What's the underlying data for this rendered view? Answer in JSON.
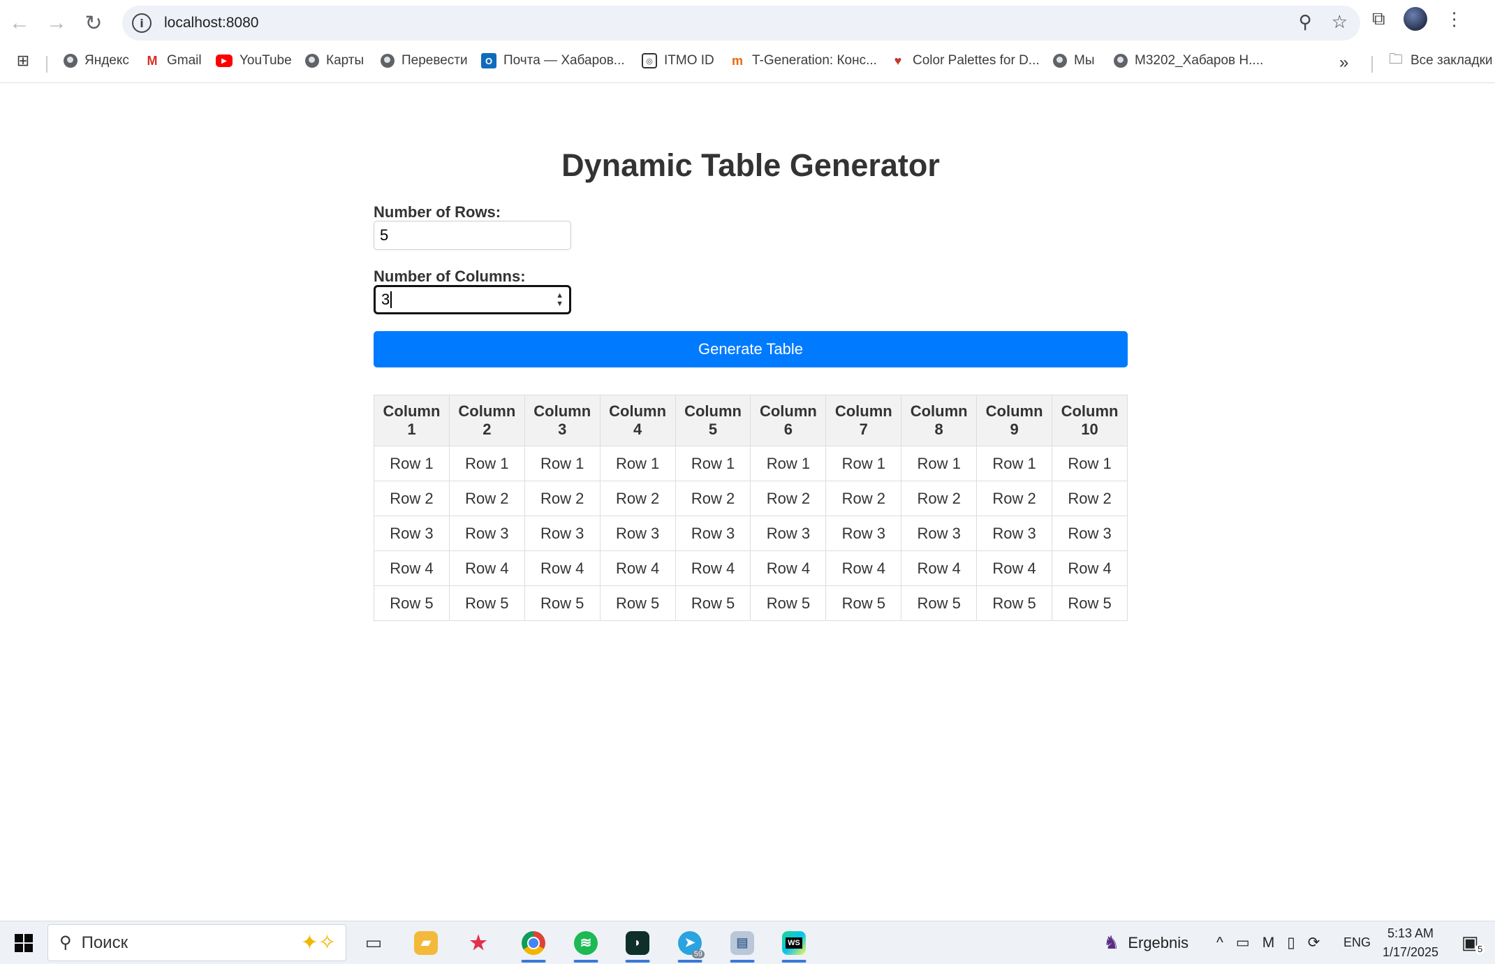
{
  "browser": {
    "url": "localhost:8080",
    "bookmarks": [
      {
        "label": "Яндекс",
        "icon": "globe-icon"
      },
      {
        "label": "Gmail",
        "icon": "gmail-icon"
      },
      {
        "label": "YouTube",
        "icon": "youtube-icon"
      },
      {
        "label": "Карты",
        "icon": "globe-icon"
      },
      {
        "label": "Перевести",
        "icon": "globe-icon"
      },
      {
        "label": "Почта — Хабаров...",
        "icon": "outlook-icon"
      },
      {
        "label": "ITMO ID",
        "icon": "itmo-icon"
      },
      {
        "label": "T-Generation: Конс...",
        "icon": "tgeneration-icon"
      },
      {
        "label": "Color Palettes for D...",
        "icon": "palette-icon"
      },
      {
        "label": "Мы",
        "icon": "globe-icon"
      },
      {
        "label": "M3202_Хабаров Н....",
        "icon": "globe-icon"
      }
    ],
    "all_bookmarks": "Все закладки"
  },
  "page": {
    "title": "Dynamic Table Generator",
    "rows_label": "Number of Rows:",
    "rows_value": "5",
    "cols_label": "Number of Columns:",
    "cols_value": "3",
    "button_label": "Generate Table",
    "table": {
      "headers": [
        [
          "Column",
          "1"
        ],
        [
          "Column",
          "2"
        ],
        [
          "Column",
          "3"
        ],
        [
          "Column",
          "4"
        ],
        [
          "Column",
          "5"
        ],
        [
          "Column",
          "6"
        ],
        [
          "Column",
          "7"
        ],
        [
          "Column",
          "8"
        ],
        [
          "Column",
          "9"
        ],
        [
          "Column",
          "10"
        ]
      ],
      "rows": [
        [
          "Row 1",
          "Row 1",
          "Row 1",
          "Row 1",
          "Row 1",
          "Row 1",
          "Row 1",
          "Row 1",
          "Row 1",
          "Row 1"
        ],
        [
          "Row 2",
          "Row 2",
          "Row 2",
          "Row 2",
          "Row 2",
          "Row 2",
          "Row 2",
          "Row 2",
          "Row 2",
          "Row 2"
        ],
        [
          "Row 3",
          "Row 3",
          "Row 3",
          "Row 3",
          "Row 3",
          "Row 3",
          "Row 3",
          "Row 3",
          "Row 3",
          "Row 3"
        ],
        [
          "Row 4",
          "Row 4",
          "Row 4",
          "Row 4",
          "Row 4",
          "Row 4",
          "Row 4",
          "Row 4",
          "Row 4",
          "Row 4"
        ],
        [
          "Row 5",
          "Row 5",
          "Row 5",
          "Row 5",
          "Row 5",
          "Row 5",
          "Row 5",
          "Row 5",
          "Row 5",
          "Row 5"
        ]
      ]
    }
  },
  "taskbar": {
    "search_placeholder": "Поиск",
    "telegram_badge": "59",
    "weather_label": "Ergebnis",
    "language": "ENG",
    "time": "5:13 AM",
    "date": "1/17/2025",
    "notifications": "5"
  },
  "colors": {
    "button_blue": "#007bff",
    "header_bg": "#f2f2f2",
    "border": "#dddddd"
  }
}
